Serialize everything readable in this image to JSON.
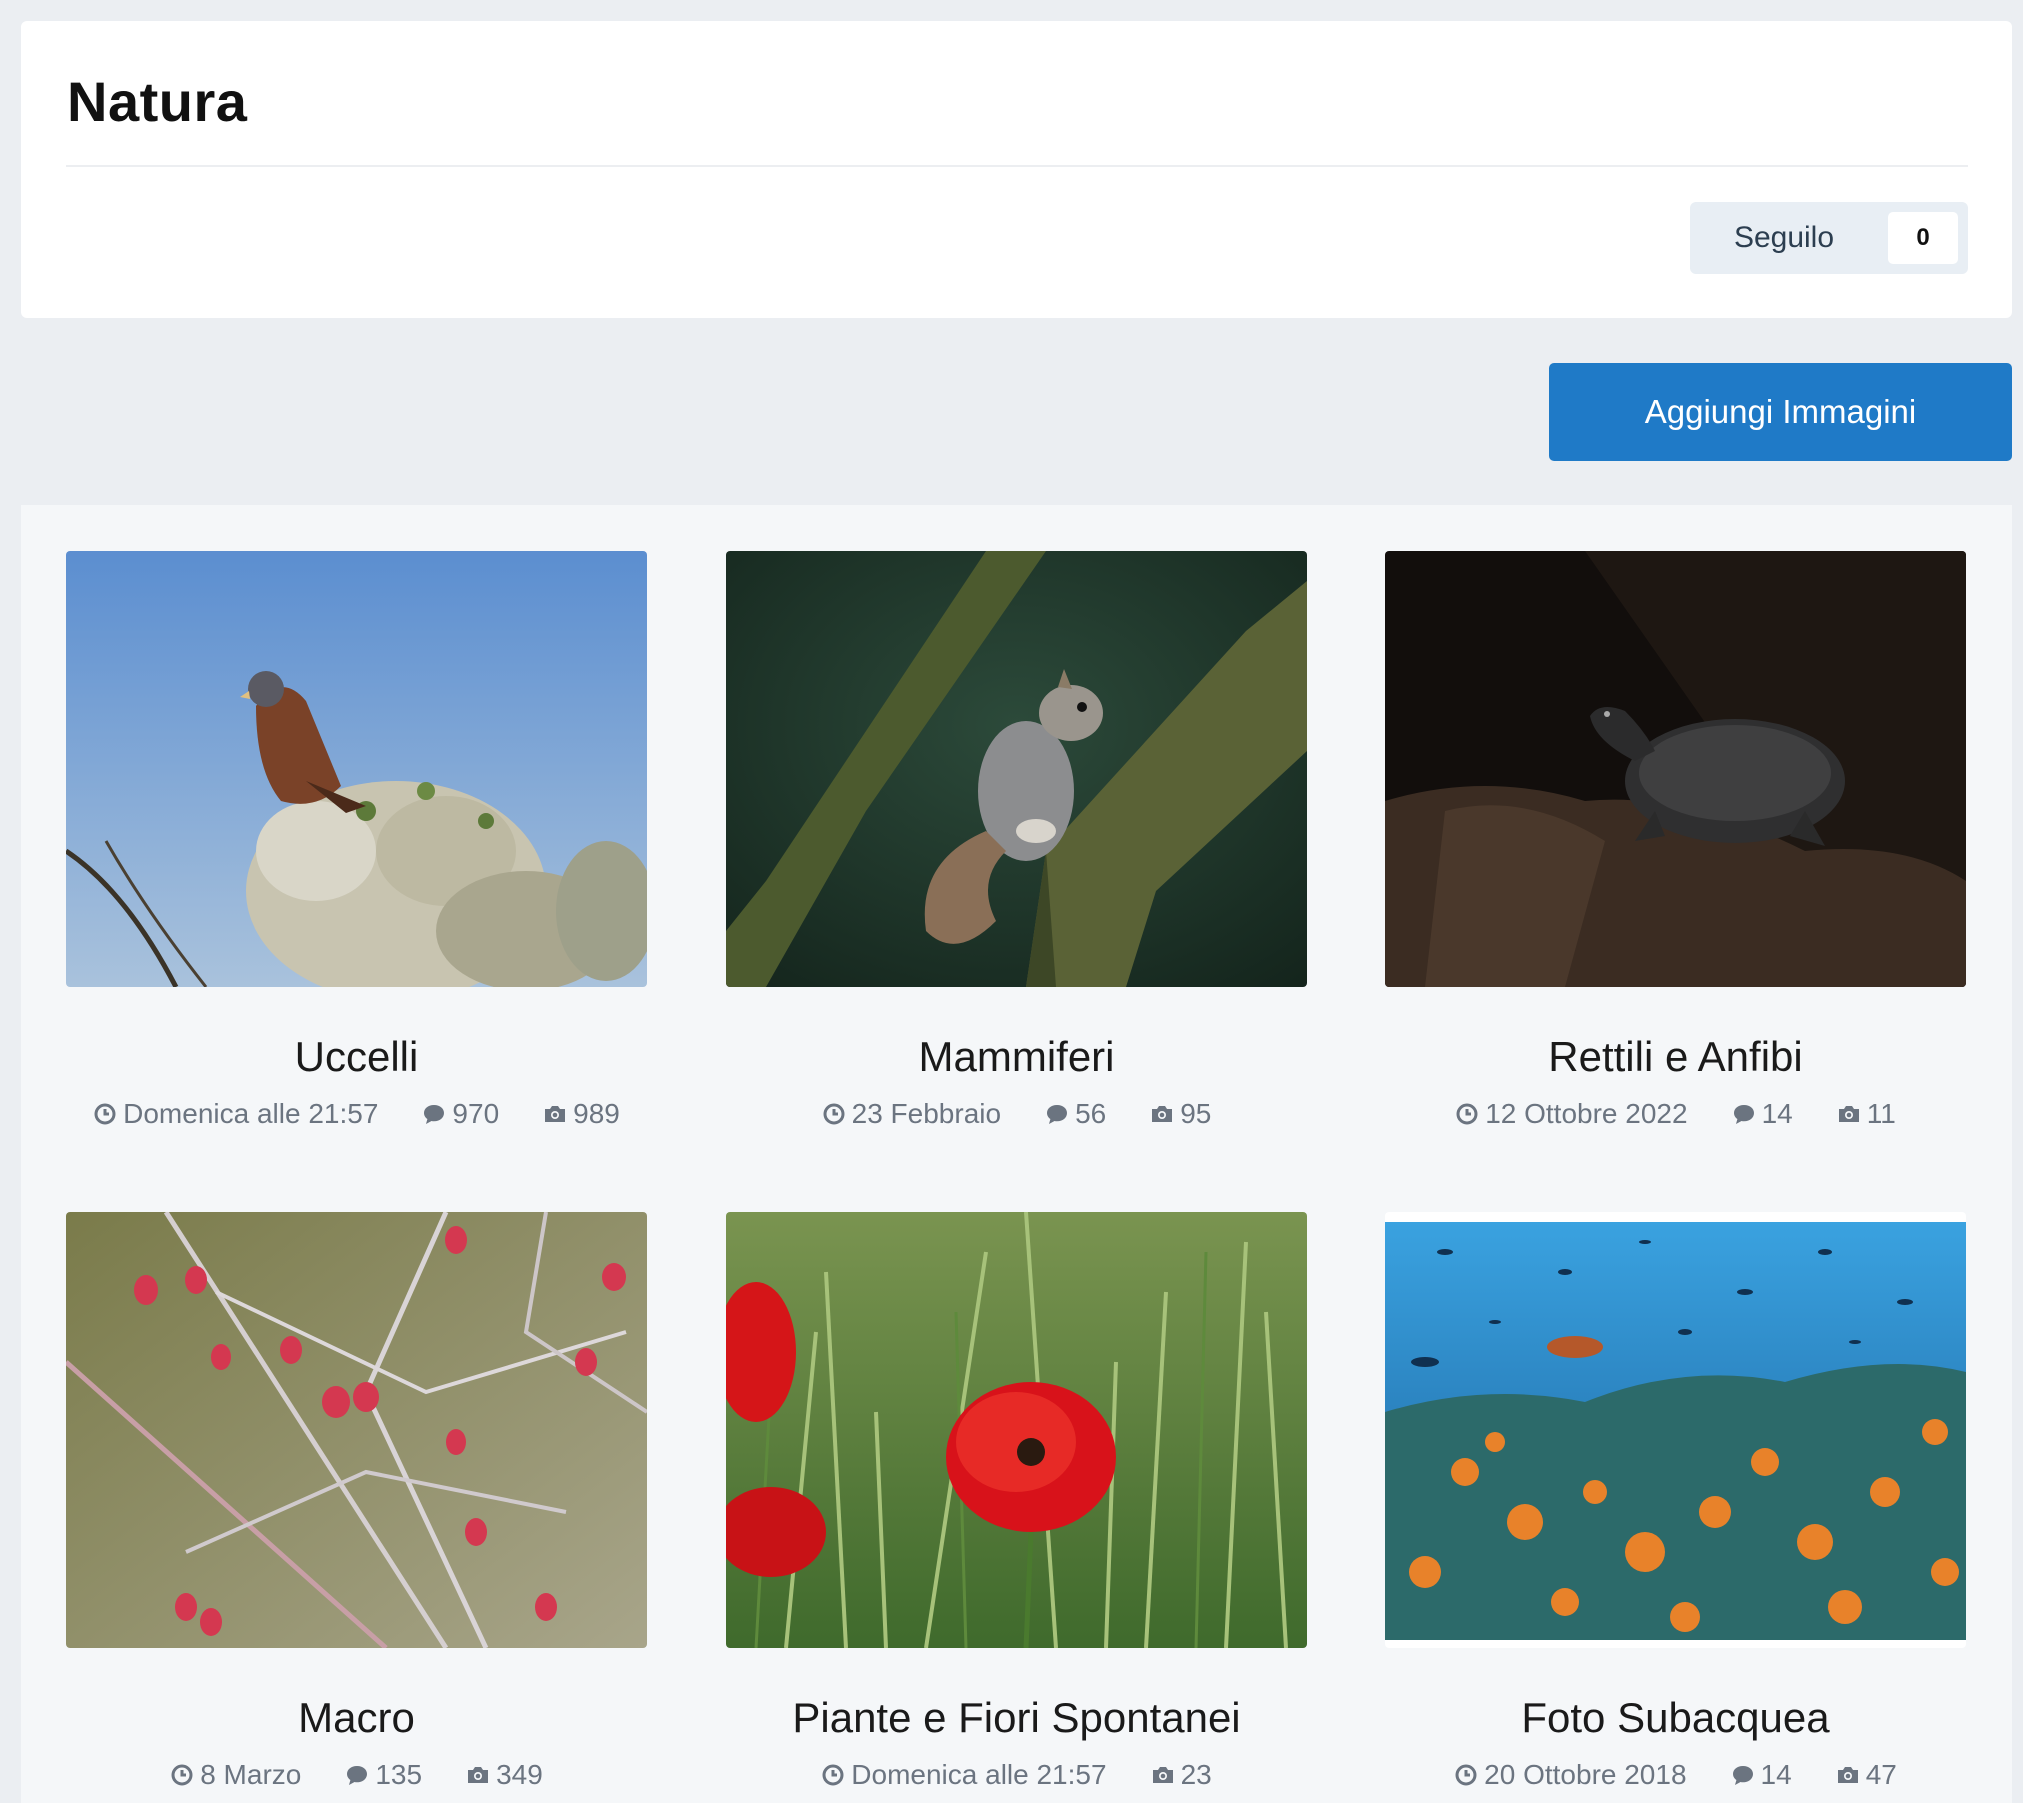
{
  "page": {
    "title": "Natura",
    "follow_label": "Seguilo",
    "follow_count": "0",
    "add_images_label": "Aggiungi Immagini"
  },
  "albums": [
    {
      "title": "Uccelli",
      "date": "Domenica alle 21:57",
      "comments": "970",
      "images": "989",
      "thumb": "bird-on-blossoms"
    },
    {
      "title": "Mammiferi",
      "date": "23 Febbraio",
      "comments": "56",
      "images": "95",
      "thumb": "squirrel-on-branch"
    },
    {
      "title": "Rettili e Anfibi",
      "date": "12 Ottobre 2022",
      "comments": "14",
      "images": "11",
      "thumb": "turtle-on-log"
    },
    {
      "title": "Macro",
      "date": "8 Marzo",
      "comments": "135",
      "images": "349",
      "thumb": "frosted-berries"
    },
    {
      "title": "Piante e Fiori Spontanei",
      "date": "Domenica alle 21:57",
      "images": "23",
      "thumb": "red-poppies"
    },
    {
      "title": "Foto Subacquea",
      "date": "20 Ottobre 2018",
      "comments": "14",
      "images": "47",
      "thumb": "underwater-reef"
    }
  ],
  "colors": {
    "background": "#ebeef2",
    "primary_button": "#1f7ac7",
    "follow_button": "#e8eef4",
    "meta_text": "#6b7480"
  },
  "icons": {
    "date": "clock-icon",
    "comments": "comment-icon",
    "images": "camera-icon"
  }
}
